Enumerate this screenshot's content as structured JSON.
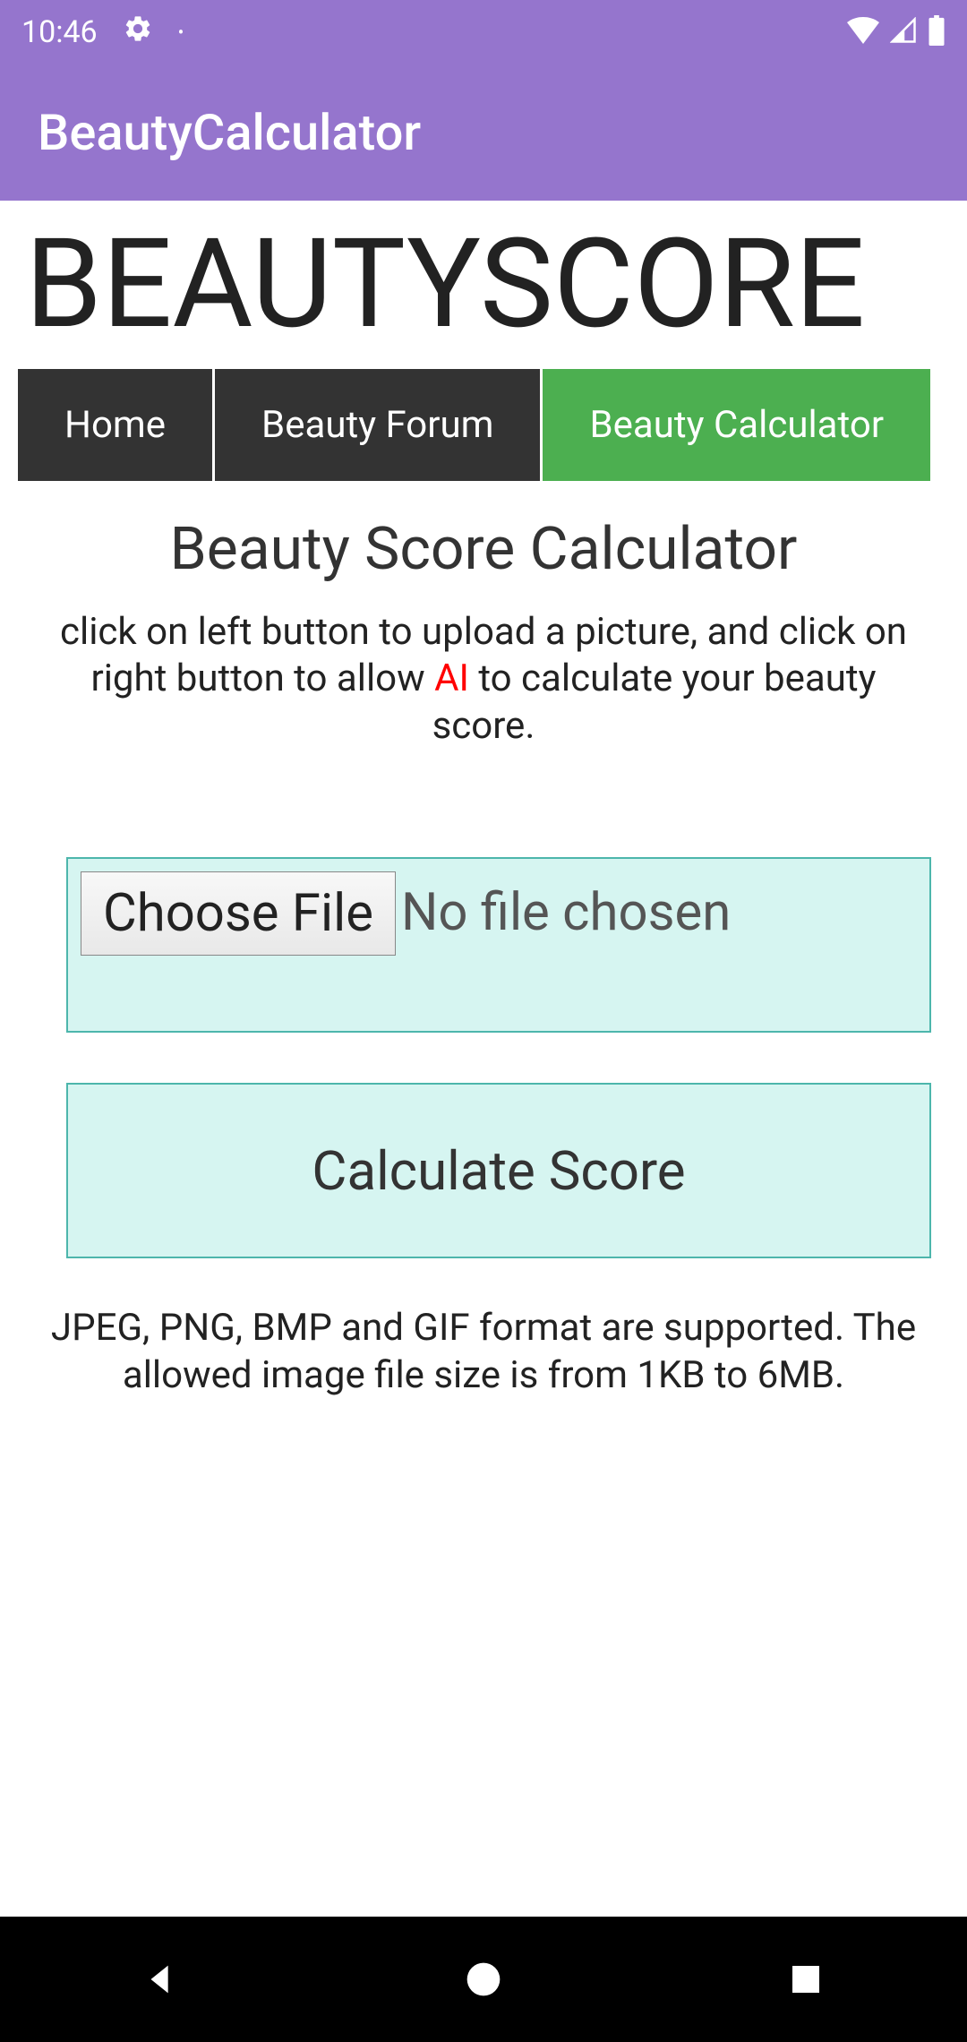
{
  "status": {
    "time": "10:46"
  },
  "app": {
    "title": "BeautyCalculator"
  },
  "banner": "BEAUTYSCORE",
  "nav": {
    "items": [
      {
        "label": "Home",
        "active": false
      },
      {
        "label": "Beauty Forum",
        "active": false
      },
      {
        "label": "Beauty Calculator",
        "active": true
      }
    ]
  },
  "main": {
    "heading": "Beauty Score Calculator",
    "instruction_pre": "click on left button to upload a picture, and click on right button to allow ",
    "instruction_ai": "AI",
    "instruction_post": " to calculate your beauty score.",
    "choose_file_label": "Choose File",
    "file_status": "No file chosen",
    "calculate_label": "Calculate Score",
    "format_info": "JPEG, PNG, BMP and GIF format are supported. The allowed image file size is from 1KB to 6MB."
  }
}
